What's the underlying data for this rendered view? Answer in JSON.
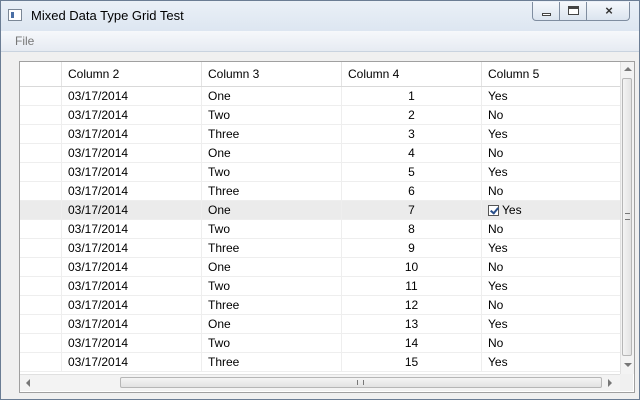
{
  "window": {
    "title": "Mixed Data Type Grid Test"
  },
  "menu": {
    "file": "File"
  },
  "grid": {
    "headers": [
      "",
      "Column 2",
      "Column 3",
      "Column 4",
      "Column 5"
    ],
    "rows": [
      {
        "c2": "03/17/2014",
        "c3": "One",
        "c4": "1",
        "c5": "Yes"
      },
      {
        "c2": "03/17/2014",
        "c3": "Two",
        "c4": "2",
        "c5": "No"
      },
      {
        "c2": "03/17/2014",
        "c3": "Three",
        "c4": "3",
        "c5": "Yes"
      },
      {
        "c2": "03/17/2014",
        "c3": "One",
        "c4": "4",
        "c5": "No"
      },
      {
        "c2": "03/17/2014",
        "c3": "Two",
        "c4": "5",
        "c5": "Yes"
      },
      {
        "c2": "03/17/2014",
        "c3": "Three",
        "c4": "6",
        "c5": "No"
      },
      {
        "c2": "03/17/2014",
        "c3": "One",
        "c4": "7",
        "c5": "Yes"
      },
      {
        "c2": "03/17/2014",
        "c3": "Two",
        "c4": "8",
        "c5": "No"
      },
      {
        "c2": "03/17/2014",
        "c3": "Three",
        "c4": "9",
        "c5": "Yes"
      },
      {
        "c2": "03/17/2014",
        "c3": "One",
        "c4": "10",
        "c5": "No"
      },
      {
        "c2": "03/17/2014",
        "c3": "Two",
        "c4": "11",
        "c5": "Yes"
      },
      {
        "c2": "03/17/2014",
        "c3": "Three",
        "c4": "12",
        "c5": "No"
      },
      {
        "c2": "03/17/2014",
        "c3": "One",
        "c4": "13",
        "c5": "Yes"
      },
      {
        "c2": "03/17/2014",
        "c3": "Two",
        "c4": "14",
        "c5": "No"
      },
      {
        "c2": "03/17/2014",
        "c3": "Three",
        "c4": "15",
        "c5": "Yes"
      }
    ],
    "selected_row": 6,
    "selected_checked": true
  },
  "icons": {
    "close": "×",
    "scroll_grip": "|||"
  }
}
